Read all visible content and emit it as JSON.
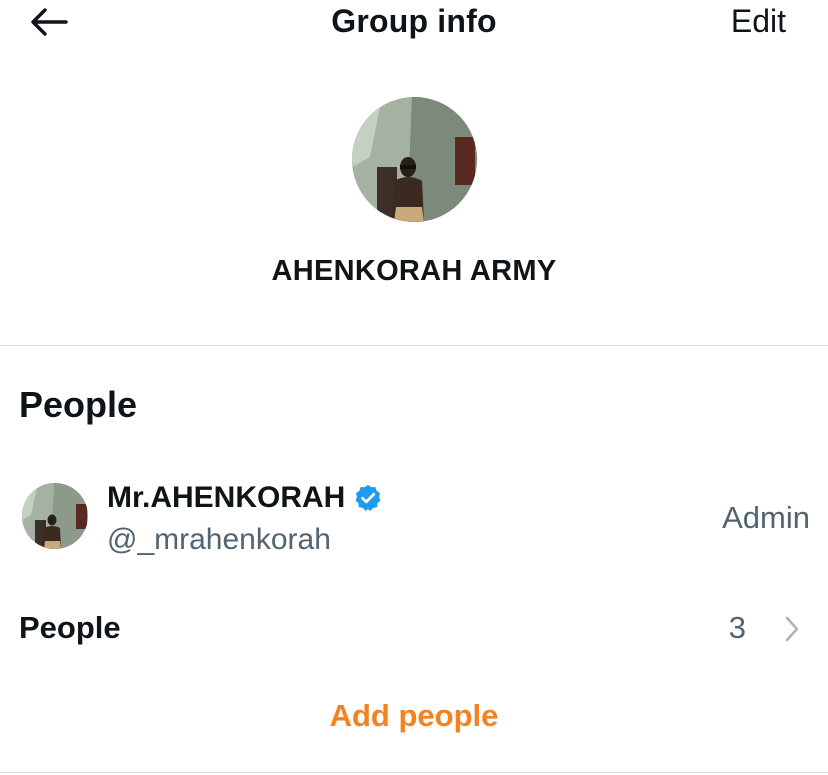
{
  "header": {
    "title": "Group info",
    "edit_label": "Edit",
    "back_icon": "arrow-left-icon"
  },
  "group": {
    "name": "AHENKORAH ARMY",
    "avatar_icon": "group-photo"
  },
  "people_section": {
    "title": "People",
    "members": [
      {
        "name": "Mr.AHENKORAH",
        "handle": "@_mrahenkorah",
        "role": "Admin",
        "verified": true,
        "verified_icon": "verified-badge-icon"
      }
    ],
    "people_row": {
      "label": "People",
      "count": "3",
      "icon": "chevron-right-icon"
    },
    "add_people_label": "Add people"
  },
  "colors": {
    "accent": "#f58220",
    "verified": "#1d9bf0",
    "secondary_text": "#536471",
    "primary_text": "#0f1419",
    "divider": "#d8dde2"
  }
}
